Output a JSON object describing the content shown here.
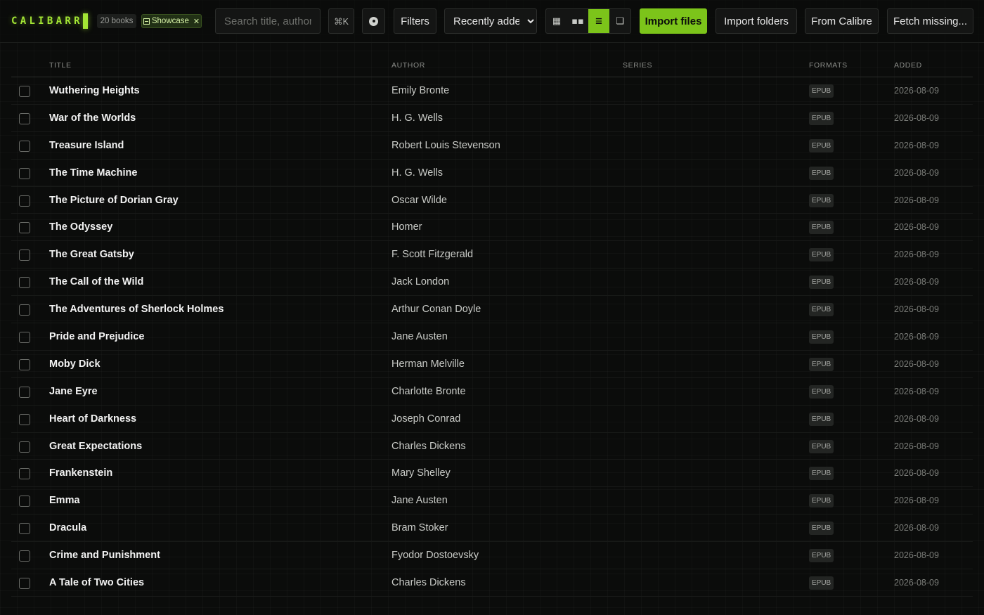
{
  "app": {
    "logo": "CALIBARR",
    "book_count": "20 books",
    "active_shelf": "Showcase"
  },
  "toolbar": {
    "search_placeholder": "Search title, author, series",
    "shortcut": "⌘K",
    "filters_label": "Filters",
    "sort_selected": "Recently added",
    "views": [
      {
        "icon": "grid-view-icon",
        "glyph": "▦",
        "active": false
      },
      {
        "icon": "compact-grid-icon",
        "glyph": "▪▪",
        "active": false
      },
      {
        "icon": "list-view-icon",
        "glyph": "≣",
        "active": true
      },
      {
        "icon": "detail-view-icon",
        "glyph": "❏",
        "active": false
      }
    ],
    "import_files_label": "Import files",
    "import_folders_label": "Import folders",
    "from_calibre_label": "From Calibre",
    "fetch_missing_label": "Fetch missing..."
  },
  "colors": {
    "accent": "#7cc41a",
    "background": "#0b0c0b"
  },
  "table": {
    "columns": {
      "title": "TITLE",
      "author": "AUTHOR",
      "series": "SERIES",
      "formats": "FORMATS",
      "added": "ADDED"
    },
    "rows": [
      {
        "title": "Wuthering Heights",
        "author": "Emily Bronte",
        "series": "",
        "format": "EPUB",
        "added": "2026-08-09"
      },
      {
        "title": "War of the Worlds",
        "author": "H. G. Wells",
        "series": "",
        "format": "EPUB",
        "added": "2026-08-09"
      },
      {
        "title": "Treasure Island",
        "author": "Robert Louis Stevenson",
        "series": "",
        "format": "EPUB",
        "added": "2026-08-09"
      },
      {
        "title": "The Time Machine",
        "author": "H. G. Wells",
        "series": "",
        "format": "EPUB",
        "added": "2026-08-09"
      },
      {
        "title": "The Picture of Dorian Gray",
        "author": "Oscar Wilde",
        "series": "",
        "format": "EPUB",
        "added": "2026-08-09"
      },
      {
        "title": "The Odyssey",
        "author": "Homer",
        "series": "",
        "format": "EPUB",
        "added": "2026-08-09"
      },
      {
        "title": "The Great Gatsby",
        "author": "F. Scott Fitzgerald",
        "series": "",
        "format": "EPUB",
        "added": "2026-08-09"
      },
      {
        "title": "The Call of the Wild",
        "author": "Jack London",
        "series": "",
        "format": "EPUB",
        "added": "2026-08-09"
      },
      {
        "title": "The Adventures of Sherlock Holmes",
        "author": "Arthur Conan Doyle",
        "series": "",
        "format": "EPUB",
        "added": "2026-08-09"
      },
      {
        "title": "Pride and Prejudice",
        "author": "Jane Austen",
        "series": "",
        "format": "EPUB",
        "added": "2026-08-09"
      },
      {
        "title": "Moby Dick",
        "author": "Herman Melville",
        "series": "",
        "format": "EPUB",
        "added": "2026-08-09"
      },
      {
        "title": "Jane Eyre",
        "author": "Charlotte Bronte",
        "series": "",
        "format": "EPUB",
        "added": "2026-08-09"
      },
      {
        "title": "Heart of Darkness",
        "author": "Joseph Conrad",
        "series": "",
        "format": "EPUB",
        "added": "2026-08-09"
      },
      {
        "title": "Great Expectations",
        "author": "Charles Dickens",
        "series": "",
        "format": "EPUB",
        "added": "2026-08-09"
      },
      {
        "title": "Frankenstein",
        "author": "Mary Shelley",
        "series": "",
        "format": "EPUB",
        "added": "2026-08-09"
      },
      {
        "title": "Emma",
        "author": "Jane Austen",
        "series": "",
        "format": "EPUB",
        "added": "2026-08-09"
      },
      {
        "title": "Dracula",
        "author": "Bram Stoker",
        "series": "",
        "format": "EPUB",
        "added": "2026-08-09"
      },
      {
        "title": "Crime and Punishment",
        "author": "Fyodor Dostoevsky",
        "series": "",
        "format": "EPUB",
        "added": "2026-08-09"
      },
      {
        "title": "A Tale of Two Cities",
        "author": "Charles Dickens",
        "series": "",
        "format": "EPUB",
        "added": "2026-08-09"
      }
    ]
  }
}
